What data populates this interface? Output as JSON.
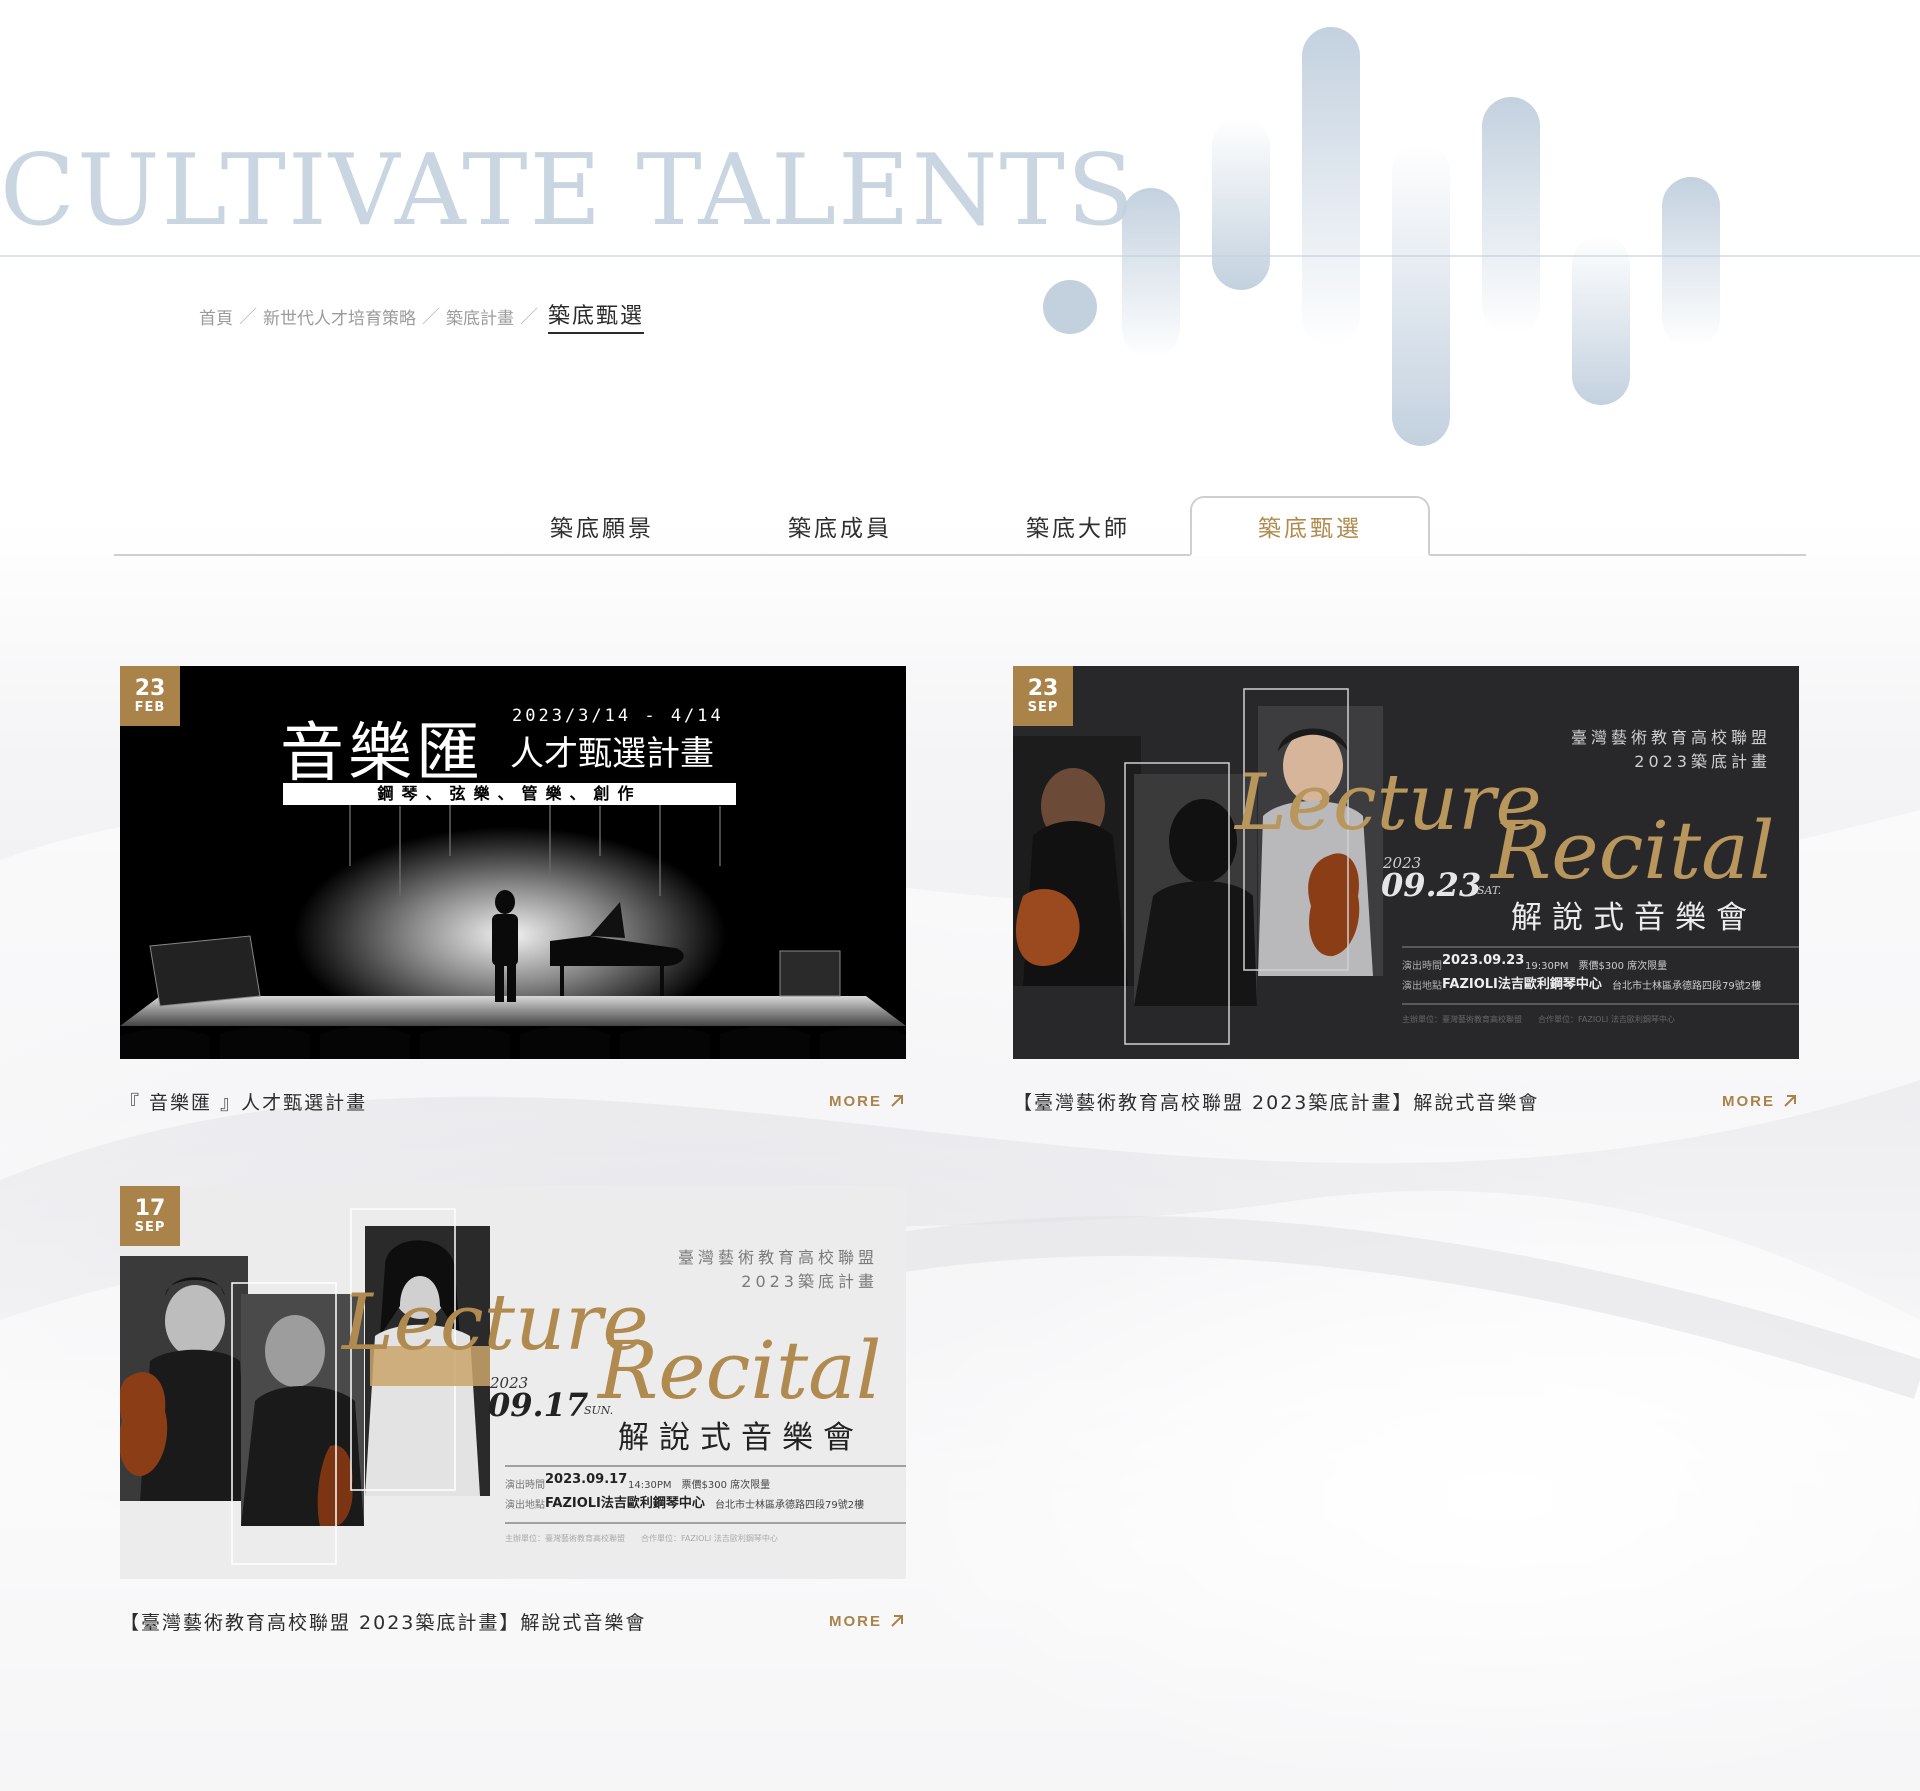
{
  "hero": {
    "title": "CULTIVATE TALENTS"
  },
  "breadcrumb": {
    "items": [
      "首頁",
      "新世代人才培育策略",
      "築底計畫"
    ],
    "separator": "／",
    "current": "築底甄選"
  },
  "tabs": [
    {
      "label": "築底願景",
      "active": false
    },
    {
      "label": "築底成員",
      "active": false
    },
    {
      "label": "築底大師",
      "active": false
    },
    {
      "label": "築底甄選",
      "active": true
    }
  ],
  "colors": {
    "accent": "#a98349",
    "hero_title": "#c9d5e1",
    "tab_active": "#b08a4e"
  },
  "cards": [
    {
      "date_day": "23",
      "date_month": "FEB",
      "title": "『 音樂匯 』人才甄選計畫",
      "more": "MORE",
      "poster": {
        "big": "音樂匯",
        "dates": "2023/3/14 - 4/14",
        "sub": "人才甄選計畫",
        "banner": "鋼琴、弦樂、管樂、創作"
      }
    },
    {
      "date_day": "23",
      "date_month": "SEP",
      "title": "【臺灣藝術教育高校聯盟 2023築底計畫】解說式音樂會",
      "more": "MORE",
      "poster": {
        "org": "臺灣藝術教育高校聯盟",
        "plan": "2023築底計畫",
        "script1": "Lecture",
        "script2": "Recital",
        "year": "2023",
        "date": "09.23",
        "weekday": "SAT.",
        "event": "解說式音樂會",
        "time_label": "演出時間",
        "time": "2023.09.23",
        "time_detail": "19:30PM　票價$300 席次限量",
        "venue_label": "演出地點",
        "venue": "FAZIOLI法吉歐利鋼琴中心",
        "address": "台北市士林區承德路四段79號2樓",
        "organizers": "主辦單位：臺灣藝術教育高校聯盟　　合作單位：FAZIOLI 法吉歐利鋼琴中心"
      }
    },
    {
      "date_day": "17",
      "date_month": "SEP",
      "title": "【臺灣藝術教育高校聯盟 2023築底計畫】解說式音樂會",
      "more": "MORE",
      "poster": {
        "org": "臺灣藝術教育高校聯盟",
        "plan": "2023築底計畫",
        "script1": "Lecture",
        "script2": "Recital",
        "year": "2023",
        "date": "09.17",
        "weekday": "SUN.",
        "event": "解說式音樂會",
        "time_label": "演出時間",
        "time": "2023.09.17",
        "time_detail": "14:30PM　票價$300 席次限量",
        "venue_label": "演出地點",
        "venue": "FAZIOLI法吉歐利鋼琴中心",
        "address": "台北市士林區承德路四段79號2樓",
        "organizers": "主辦單位：臺灣藝術教育高校聯盟　　合作單位：FAZIOLI 法吉歐利鋼琴中心"
      }
    }
  ]
}
